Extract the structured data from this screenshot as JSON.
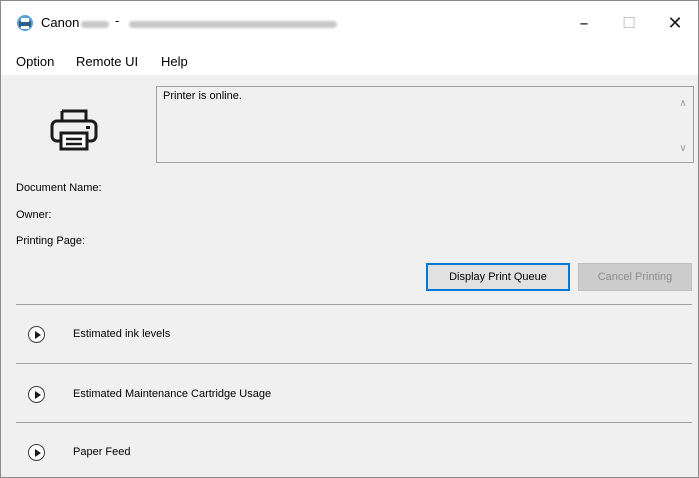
{
  "window": {
    "title_prefix": "Canon",
    "title_separator": "-",
    "controls": {
      "minimize": "–",
      "maximize": "☐",
      "close": "✕"
    }
  },
  "menu": [
    "Option",
    "Remote UI",
    "Help"
  ],
  "status": {
    "message": "Printer is online."
  },
  "fields": {
    "document_name": "Document Name:",
    "owner": "Owner:",
    "printing_page": "Printing Page:"
  },
  "buttons": {
    "display_queue": "Display Print Queue",
    "cancel_printing": "Cancel Printing"
  },
  "sections": [
    {
      "label": "Estimated ink levels"
    },
    {
      "label": "Estimated Maintenance Cartridge Usage"
    },
    {
      "label": "Paper Feed"
    }
  ],
  "colors": {
    "accent_focus": "#0078d7",
    "window_bg": "#f0f0f0",
    "disabled_text": "#8d8d8d"
  }
}
